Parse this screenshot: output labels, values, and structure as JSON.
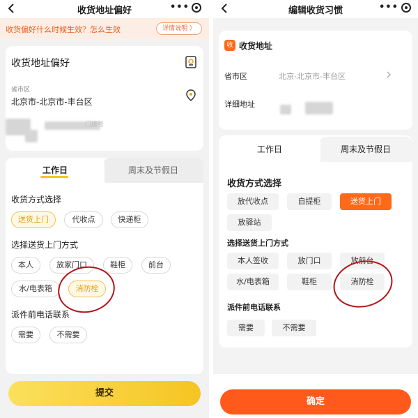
{
  "left": {
    "nav": {
      "title": "收货地址偏好",
      "more": "•••"
    },
    "banner": {
      "text": "收货偏好什么时候生效？怎么生效",
      "button": "详情说明 〉"
    },
    "address_card": {
      "title": "收货地址偏好",
      "region_label": "省市区",
      "region_value": "北京市-北京市-丰台区",
      "detail_hint": "门牌号"
    },
    "tabs": [
      {
        "label": "工作日"
      },
      {
        "label": "周末及节假日"
      }
    ],
    "method": {
      "title": "收货方式选择",
      "options": [
        {
          "label": "送货上门"
        },
        {
          "label": "代收点"
        },
        {
          "label": "快递柜"
        }
      ]
    },
    "door": {
      "title": "选择送货上门方式",
      "options": [
        {
          "label": "本人"
        },
        {
          "label": "放家门口"
        },
        {
          "label": "鞋柜"
        },
        {
          "label": "前台"
        },
        {
          "label": "水/电表箱"
        },
        {
          "label": "消防栓"
        }
      ]
    },
    "call": {
      "title": "派件前电话联系",
      "options": [
        {
          "label": "需要"
        },
        {
          "label": "不需要"
        }
      ]
    },
    "submit": "提交"
  },
  "right": {
    "nav": {
      "title": "编辑收货习惯",
      "more": "•••"
    },
    "address_card": {
      "badge": "收",
      "title": "收货地址",
      "region_label": "省市区",
      "region_value": "北京-北京市-丰台区",
      "detail_label": "详细地址"
    },
    "tabs": [
      {
        "label": "工作日"
      },
      {
        "label": "周末及节假日"
      }
    ],
    "method": {
      "title": "收货方式选择",
      "options": [
        {
          "label": "放代收点"
        },
        {
          "label": "自提柜"
        },
        {
          "label": "送货上门"
        },
        {
          "label": "放驿站"
        }
      ]
    },
    "door": {
      "title": "选择送货上门方式",
      "options": [
        {
          "label": "本人签收"
        },
        {
          "label": "放门口"
        },
        {
          "label": "放前台"
        },
        {
          "label": "水/电表箱"
        },
        {
          "label": "鞋柜"
        },
        {
          "label": "消防栓"
        }
      ]
    },
    "call": {
      "title": "派件前电话联系",
      "options": [
        {
          "label": "需要"
        },
        {
          "label": "不需要"
        }
      ]
    },
    "confirm": "确定"
  },
  "colors": {
    "accent_yellow": "#f6c423",
    "accent_orange": "#ff5a1c",
    "annotation_red": "#b2141b"
  }
}
